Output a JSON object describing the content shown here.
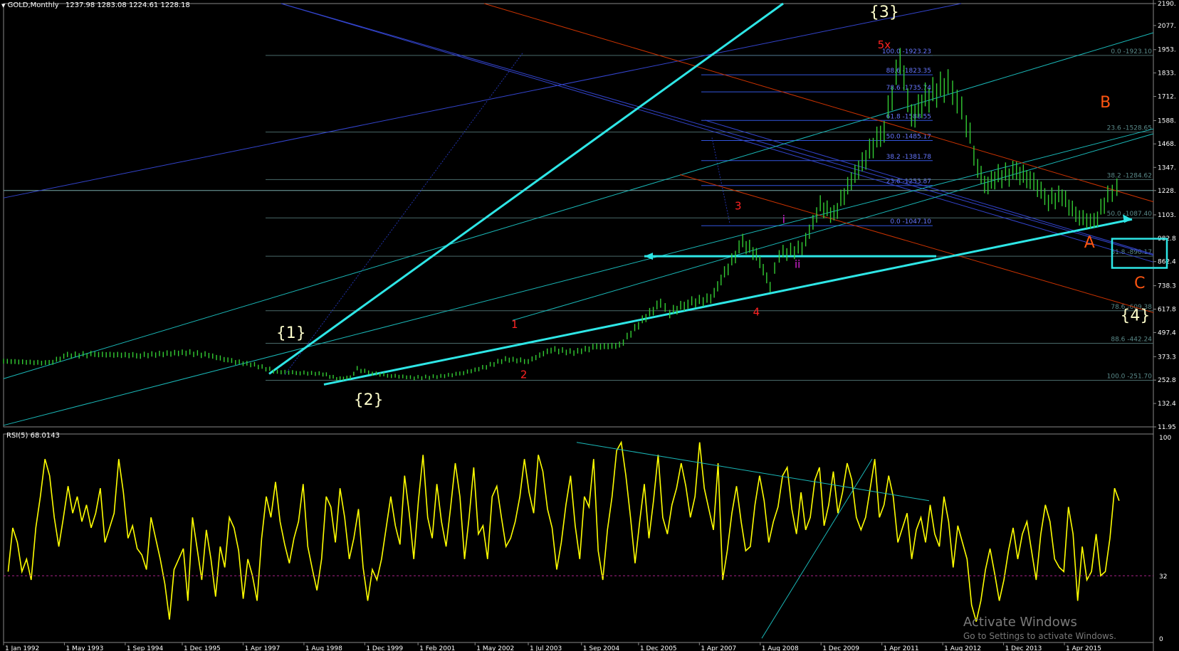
{
  "window": {
    "symbol_title": "GOLD,Monthly",
    "ohlc": "1237.98 1283.08 1224.61 1228.18",
    "rsi_title": "RSI(5) 68.0143"
  },
  "activation": {
    "title": "Activate Windows",
    "subtitle": "Go to Settings to activate Windows."
  },
  "colors": {
    "background": "#000000",
    "candles": "#33cc33",
    "rsi": "#ffff00",
    "fib": "#3355dd",
    "channel_blue": "#3344cc",
    "channel_cyan": "#1ab8b8",
    "trend_bold": "#2ee6e6",
    "channel_red": "#cc3300",
    "wave_red": "#ff2222",
    "wave_magenta": "#dd22dd",
    "wave_orange": "#ff5511",
    "wave_white": "#ffffcc"
  },
  "chart_data": [
    {
      "type": "line",
      "name": "GOLD,Monthly",
      "yticks": [
        "2190.",
        "2077.",
        "1953.",
        "1833.",
        "1712.",
        "1588.",
        "1468.",
        "1347.",
        "1228.",
        "1103.",
        "982.8",
        "862.4",
        "738.3",
        "617.8",
        "497.4",
        "373.3",
        "252.8",
        "132.4",
        "11.95"
      ],
      "ylim": [
        11.95,
        2190
      ],
      "xlim": [
        1992.0,
        2017.2
      ],
      "xticks": [
        "1 Jan 1992",
        "1 May 1993",
        "1 Sep 1994",
        "1 Dec 1995",
        "1 Apr 1997",
        "1 Aug 1998",
        "1 Dec 1999",
        "1 Feb 2001",
        "1 May 2002",
        "1 Jul 2003",
        "1 Sep 2004",
        "1 Dec 2005",
        "1 Apr 2007",
        "1 Aug 2008",
        "1 Dec 2009",
        "1 Apr 2011",
        "1 Aug 2012",
        "1 Dec 2013",
        "1 Apr 2015"
      ],
      "price": [
        [
          1992.0,
          350
        ],
        [
          1993.0,
          340
        ],
        [
          1993.4,
          380
        ],
        [
          1994.0,
          385
        ],
        [
          1995.0,
          380
        ],
        [
          1996.0,
          395
        ],
        [
          1996.5,
          380
        ],
        [
          1997.0,
          350
        ],
        [
          1997.5,
          330
        ],
        [
          1998.0,
          295
        ],
        [
          1998.5,
          290
        ],
        [
          1999.0,
          285
        ],
        [
          1999.3,
          260
        ],
        [
          1999.6,
          265
        ],
        [
          1999.75,
          310
        ],
        [
          2000.0,
          290
        ],
        [
          2000.5,
          275
        ],
        [
          2001.0,
          265
        ],
        [
          2001.5,
          270
        ],
        [
          2002.0,
          285
        ],
        [
          2002.5,
          315
        ],
        [
          2003.0,
          360
        ],
        [
          2003.5,
          350
        ],
        [
          2004.0,
          410
        ],
        [
          2004.5,
          395
        ],
        [
          2005.0,
          425
        ],
        [
          2005.5,
          430
        ],
        [
          2006.0,
          560
        ],
        [
          2006.4,
          650
        ],
        [
          2006.6,
          600
        ],
        [
          2007.0,
          650
        ],
        [
          2007.5,
          670
        ],
        [
          2007.8,
          800
        ],
        [
          2008.2,
          960
        ],
        [
          2008.5,
          900
        ],
        [
          2008.8,
          740
        ],
        [
          2009.0,
          900
        ],
        [
          2009.5,
          930
        ],
        [
          2009.9,
          1150
        ],
        [
          2010.2,
          1100
        ],
        [
          2010.5,
          1250
        ],
        [
          2010.9,
          1400
        ],
        [
          2011.3,
          1550
        ],
        [
          2011.65,
          1900
        ],
        [
          2011.9,
          1600
        ],
        [
          2012.2,
          1700
        ],
        [
          2012.7,
          1780
        ],
        [
          2012.9,
          1700
        ],
        [
          2013.1,
          1580
        ],
        [
          2013.35,
          1350
        ],
        [
          2013.5,
          1250
        ],
        [
          2013.8,
          1300
        ],
        [
          2014.2,
          1320
        ],
        [
          2014.5,
          1290
        ],
        [
          2014.9,
          1180
        ],
        [
          2015.2,
          1200
        ],
        [
          2015.5,
          1100
        ],
        [
          2015.9,
          1060
        ],
        [
          2016.2,
          1200
        ],
        [
          2016.4,
          1250
        ],
        [
          2016.5,
          1228
        ]
      ],
      "fib_levels_left": [
        {
          "label": "100.0 -1923.23",
          "value": 1923.23
        },
        {
          "label": "88.6 -1823.35",
          "value": 1823.35
        },
        {
          "label": "78.6 -1735.74",
          "value": 1735.74
        },
        {
          "label": "61.8 -1588.55",
          "value": 1588.55
        },
        {
          "label": "50.0 -1485.17",
          "value": 1485.17
        },
        {
          "label": "38.2 -1381.78",
          "value": 1381.78
        },
        {
          "label": "23.6 -1253.87",
          "value": 1253.87
        },
        {
          "label": "0.0 -1047.10",
          "value": 1047.1
        }
      ],
      "fib_levels_right": [
        {
          "label": "0.0 -1923.10",
          "value": 1923.1
        },
        {
          "label": "23.6 -1528.65",
          "value": 1528.65
        },
        {
          "label": "38.2 -1284.62",
          "value": 1284.62
        },
        {
          "label": "50.0 -1087.40",
          "value": 1087.4
        },
        {
          "label": "61.8 -890.17",
          "value": 890.17
        },
        {
          "label": "78.6 -609.38",
          "value": 609.38
        },
        {
          "label": "88.6 -442.24",
          "value": 442.24
        },
        {
          "label": "100.0 -251.70",
          "value": 251.7
        }
      ],
      "wave_labels": [
        {
          "text": "{1}",
          "x": 1998.3,
          "y": 470,
          "color": "#ffffcc"
        },
        {
          "text": "{2}",
          "x": 2000.0,
          "y": 125,
          "color": "#ffffcc"
        },
        {
          "text": "{3}",
          "x": 2011.3,
          "y": 2120,
          "color": "#ffffcc"
        },
        {
          "text": "{4}",
          "x": 2016.8,
          "y": 560,
          "color": "#ffffcc"
        },
        {
          "text": "5x",
          "x": 2011.3,
          "y": 1960,
          "color": "#ff2222"
        },
        {
          "text": "1",
          "x": 2003.2,
          "y": 520,
          "color": "#ff2222"
        },
        {
          "text": "2",
          "x": 2003.4,
          "y": 262,
          "color": "#ff2222"
        },
        {
          "text": "3",
          "x": 2008.1,
          "y": 1130,
          "color": "#ff2222"
        },
        {
          "text": "4",
          "x": 2008.5,
          "y": 585,
          "color": "#ff2222"
        },
        {
          "text": "i",
          "x": 2009.1,
          "y": 1060,
          "color": "#dd22dd"
        },
        {
          "text": "ii",
          "x": 2009.4,
          "y": 830,
          "color": "#dd22dd"
        },
        {
          "text": "A",
          "x": 2015.8,
          "y": 935,
          "color": "#ff5511"
        },
        {
          "text": "B",
          "x": 2016.15,
          "y": 1655,
          "color": "#ff5511"
        },
        {
          "text": "C",
          "x": 2016.9,
          "y": 725,
          "color": "#ff5511"
        }
      ]
    },
    {
      "type": "line",
      "name": "RSI(5) 68.0143",
      "ylim": [
        0,
        100
      ],
      "yticks": [
        "100",
        "32",
        "0"
      ],
      "level": 32,
      "values": [
        34,
        55,
        48,
        34,
        40,
        30,
        55,
        70,
        88,
        80,
        60,
        46,
        60,
        75,
        62,
        70,
        58,
        66,
        55,
        62,
        74,
        48,
        55,
        62,
        88,
        72,
        50,
        56,
        45,
        42,
        35,
        60,
        50,
        40,
        28,
        11,
        35,
        40,
        45,
        20,
        60,
        45,
        30,
        54,
        40,
        22,
        46,
        36,
        60,
        55,
        44,
        21,
        40,
        32,
        20,
        50,
        70,
        60,
        77,
        58,
        47,
        38,
        50,
        58,
        76,
        46,
        35,
        25,
        40,
        70,
        65,
        48,
        74,
        60,
        40,
        50,
        64,
        36,
        20,
        35,
        30,
        40,
        55,
        70,
        56,
        47,
        80,
        62,
        40,
        68,
        90,
        60,
        50,
        76,
        58,
        46,
        65,
        86,
        70,
        40,
        60,
        84,
        52,
        56,
        40,
        70,
        75,
        60,
        46,
        50,
        58,
        70,
        88,
        72,
        62,
        90,
        82,
        64,
        55,
        35,
        48,
        66,
        80,
        56,
        40,
        70,
        65,
        88,
        44,
        30,
        54,
        70,
        92,
        96,
        80,
        60,
        38,
        58,
        76,
        50,
        68,
        90,
        60,
        52,
        66,
        74,
        86,
        75,
        60,
        70,
        96,
        74,
        64,
        54,
        86,
        30,
        44,
        62,
        75,
        58,
        44,
        46,
        66,
        80,
        68,
        48,
        58,
        65,
        80,
        84,
        64,
        52,
        72,
        54,
        60,
        78,
        84,
        56,
        66,
        82,
        62,
        72,
        86,
        78,
        60,
        54,
        60,
        74,
        88,
        60,
        66,
        80,
        70,
        48,
        55,
        62,
        40,
        54,
        60,
        48,
        66,
        52,
        46,
        70,
        58,
        36,
        56,
        48,
        40,
        18,
        10,
        20,
        35,
        45,
        33,
        20,
        30,
        44,
        55,
        40,
        52,
        58,
        44,
        30,
        52,
        66,
        58,
        40,
        36,
        34,
        65,
        52,
        20,
        46,
        30,
        34,
        52,
        32,
        34,
        50,
        74,
        68
      ]
    }
  ]
}
